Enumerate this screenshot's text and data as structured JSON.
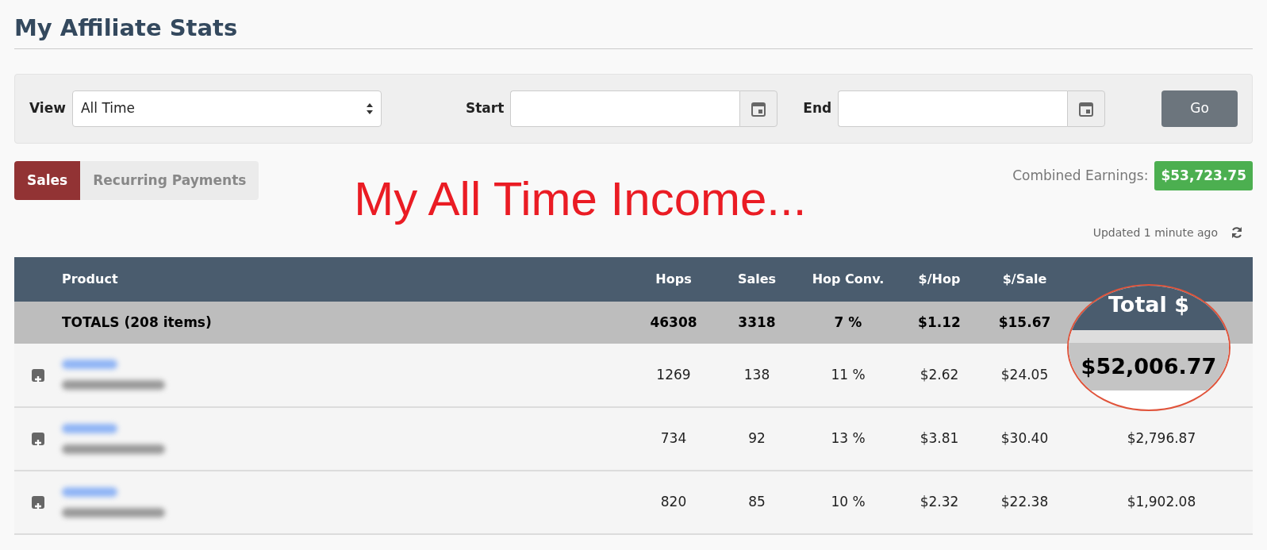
{
  "page": {
    "title": "My Affiliate Stats"
  },
  "filters": {
    "view_label": "View",
    "view_value": "All Time",
    "start_label": "Start",
    "end_label": "End",
    "go_button": "Go"
  },
  "tabs": [
    {
      "label": "Sales",
      "selected": true
    },
    {
      "label": "Recurring Payments",
      "selected": false
    }
  ],
  "combined_earnings": {
    "label": "Combined Earnings:",
    "value": "$53,723.75"
  },
  "annotation": "My All Time Income...",
  "updated": "Updated 1 minute ago",
  "table": {
    "columns": [
      "Product",
      "Hops",
      "Sales",
      "Hop Conv.",
      "$/Hop",
      "$/Sale"
    ],
    "totals": {
      "label": "TOTALS (208 items)",
      "hops": "46308",
      "sales": "3318",
      "conv": "7 %",
      "per_hop": "$1.12",
      "per_sale": "$15.67"
    },
    "rows": [
      {
        "hops": "1269",
        "sales": "138",
        "conv": "11 %",
        "per_hop": "$2.62",
        "per_sale": "$24.05"
      },
      {
        "hops": "734",
        "sales": "92",
        "conv": "13 %",
        "per_hop": "$3.81",
        "per_sale": "$30.40",
        "total": "$2,796.87"
      },
      {
        "hops": "820",
        "sales": "85",
        "conv": "10 %",
        "per_hop": "$2.32",
        "per_sale": "$22.38",
        "total": "$1,902.08"
      }
    ]
  },
  "magnifier": {
    "heading": "Total $",
    "value": "$52,006.77"
  }
}
